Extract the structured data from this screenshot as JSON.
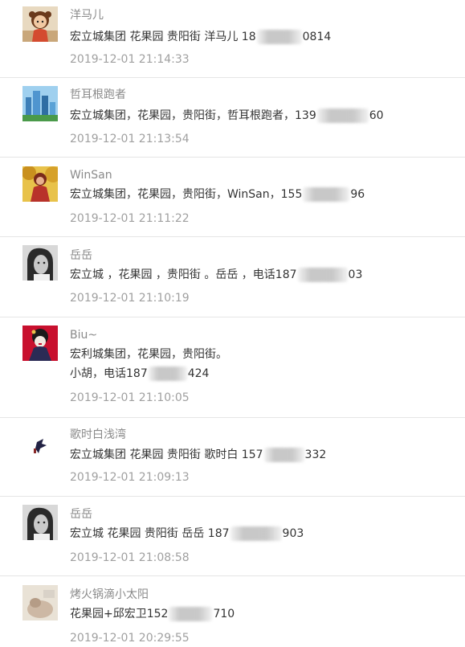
{
  "comments": [
    {
      "name": "洋马儿",
      "avatar_icon": "cartoon-girl-avatar-icon",
      "lines": [
        [
          "宏立城集团 花果园 贵阳街 洋马儿 18",
          "0814"
        ]
      ],
      "time": "2019-12-01 21:14:33"
    },
    {
      "name": "哲耳根跑者",
      "avatar_icon": "city-building-avatar-icon",
      "lines": [
        [
          "宏立城集团，花果园，贵阳街，哲耳根跑者，139",
          "60"
        ]
      ],
      "time": "2019-12-01 21:13:54"
    },
    {
      "name": "WinSan",
      "avatar_icon": "woman-autumn-avatar-icon",
      "lines": [
        [
          "宏立城集团，花果园，贵阳街，WinSan，155",
          "96"
        ]
      ],
      "time": "2019-12-01 21:11:22"
    },
    {
      "name": "岳岳",
      "avatar_icon": "bw-portrait-avatar-icon",
      "lines": [
        [
          "宏立城  ，花果园 ，贵阳街 。岳岳 ，电话187",
          "03"
        ]
      ],
      "time": "2019-12-01 21:10:19"
    },
    {
      "name": "Biu~",
      "avatar_icon": "red-geisha-avatar-icon",
      "lines": [
        [
          "宏利城集团，花果园，贵阳街。",
          ""
        ],
        [
          "小胡，电话187",
          "424"
        ]
      ],
      "time": "2019-12-01 21:10:05"
    },
    {
      "name": "歌时白浅湾",
      "avatar_icon": "ink-figure-avatar-icon",
      "lines": [
        [
          "宏立城集团 花果园 贵阳街 歌时白 157",
          "332"
        ]
      ],
      "time": "2019-12-01 21:09:13"
    },
    {
      "name": "岳岳",
      "avatar_icon": "bw-portrait-avatar-icon",
      "lines": [
        [
          "宏立城 花果园 贵阳街 岳岳 187",
          "903"
        ]
      ],
      "time": "2019-12-01 21:08:58"
    },
    {
      "name": "烤火锅滴小太阳",
      "avatar_icon": "cat-photo-avatar-icon",
      "lines": [
        [
          "花果园+邱宏卫152",
          "710"
        ]
      ],
      "time": "2019-12-01 20:29:55"
    }
  ]
}
